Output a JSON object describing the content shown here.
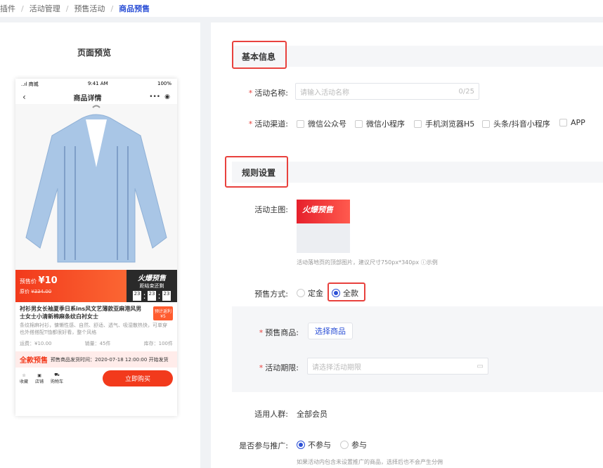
{
  "breadcrumb": {
    "items": [
      "插件",
      "活动管理",
      "预售活动"
    ],
    "current": "商品预售"
  },
  "preview": {
    "title": "页面预览",
    "status": {
      "carrier": "..ıl 商城 ",
      "time": "9:41 AM",
      "battery": "100%"
    },
    "nav_title": "商品详情",
    "presale_price_label": "预售价",
    "presale_price": "¥10",
    "orig_price_label": "原价",
    "orig_price": "¥334.00",
    "badge_title": "火爆预售",
    "badge_sub": "距结束还剩",
    "countdown": [
      "23",
      "23",
      "23"
    ],
    "product_name": "衬衫男女长袖夏季日系ins风文艺薄款亚麻港风男士女士小清新棉麻条纹白衬女士",
    "product_desc": "条纹棉麻衬衫，慵懒性感、自然、舒适、透气、吸湿散热快，可单穿也外搭搭配T恤都很好看，整个风格",
    "tag_line1": "预计返利",
    "tag_line2": "¥5",
    "shipping": "运费：¥10.00",
    "sales": "销量：45件",
    "stock": "库存：100件",
    "presale_badge": "全款预售",
    "presale_ship": "预售商品发货时间：2020-07-18 12:00:00 开始发货",
    "bottom_icons": [
      "收藏",
      "店铺",
      "购物车"
    ],
    "buy_label": "立即购买"
  },
  "form": {
    "basic_section": "基本信息",
    "name_label": "活动名称:",
    "name_placeholder": "请输入活动名称",
    "name_count": "0/25",
    "channel_label": "活动渠道:",
    "channels": [
      "微信公众号",
      "微信小程序",
      "手机浏览器H5",
      "头条/抖音小程序",
      "APP"
    ],
    "rules_section": "规则设置",
    "image_label": "活动主图:",
    "image_banner": "火爆预售",
    "image_hint": "活动落地页的顶部图片，建议尺寸750px*340px",
    "image_example": "示例",
    "mode_label": "预售方式:",
    "mode_options": [
      "定金",
      "全款"
    ],
    "goods_label": "预售商品:",
    "goods_button": "选择商品",
    "period_label": "活动期限:",
    "period_placeholder": "请选择活动期限",
    "audience_label": "适用人群:",
    "audience_value": "全部会员",
    "promo_label": "是否参与推广:",
    "promo_options": [
      "不参与",
      "参与"
    ],
    "promo_hint": "如果活动内包含未设置推广的商品，选择后也不会产生分佣"
  }
}
